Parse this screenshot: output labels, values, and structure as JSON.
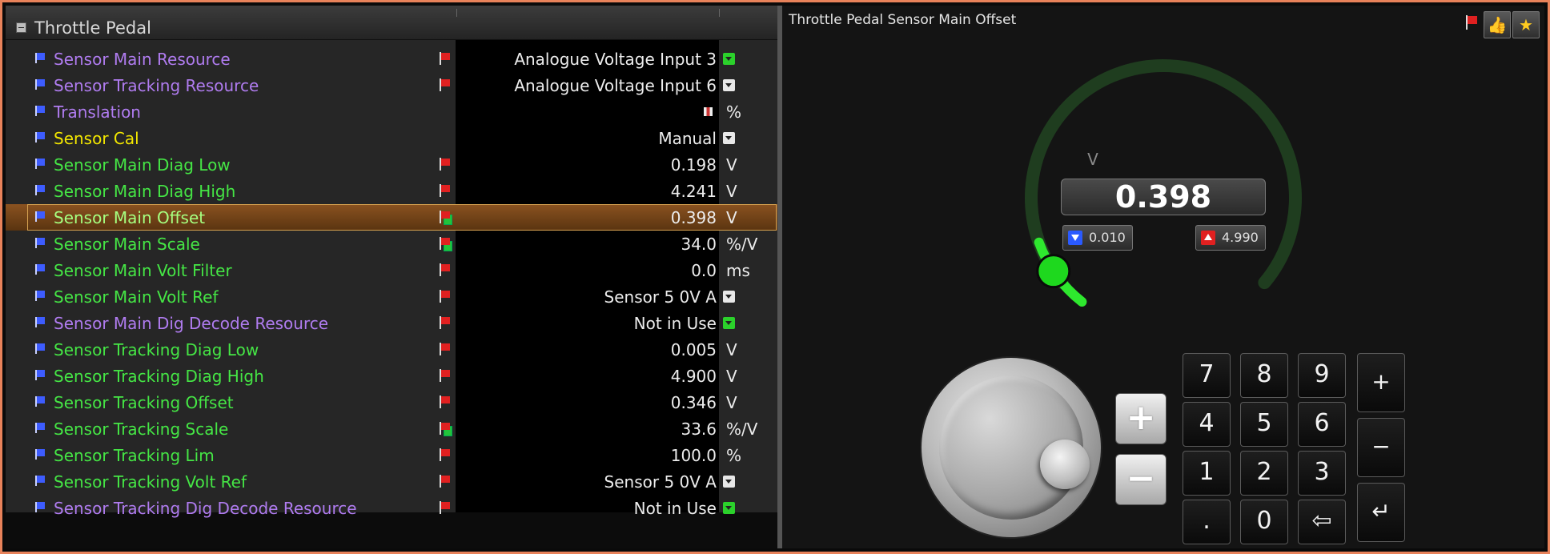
{
  "tree": {
    "title": "Throttle Pedal",
    "rows": [
      {
        "name": "Sensor Main Resource",
        "value": "Analogue Voltage Input 3",
        "unit": "",
        "color": "purple",
        "flag": true,
        "lock": false,
        "control": "dropdown-green"
      },
      {
        "name": "Sensor Tracking Resource",
        "value": "Analogue Voltage Input 6",
        "unit": "",
        "color": "purple",
        "flag": true,
        "lock": false,
        "control": "dropdown"
      },
      {
        "name": "Translation",
        "value": "",
        "unit": "%",
        "color": "purple",
        "flag": false,
        "lock": false,
        "control": "table"
      },
      {
        "name": "Sensor Cal",
        "value": "Manual",
        "unit": "",
        "color": "yellow",
        "flag": false,
        "lock": false,
        "control": "dropdown"
      },
      {
        "name": "Sensor Main Diag Low",
        "value": "0.198",
        "unit": "V",
        "color": "green",
        "flag": true,
        "lock": false,
        "control": ""
      },
      {
        "name": "Sensor Main Diag High",
        "value": "4.241",
        "unit": "V",
        "color": "green",
        "flag": true,
        "lock": false,
        "control": ""
      },
      {
        "name": "Sensor Main Offset",
        "value": "0.398",
        "unit": "V",
        "color": "sel",
        "flag": true,
        "lock": true,
        "control": "",
        "selected": true
      },
      {
        "name": "Sensor Main Scale",
        "value": "34.0",
        "unit": "%/V",
        "color": "green",
        "flag": true,
        "lock": true,
        "control": ""
      },
      {
        "name": "Sensor Main Volt Filter",
        "value": "0.0",
        "unit": "ms",
        "color": "green",
        "flag": true,
        "lock": false,
        "control": ""
      },
      {
        "name": "Sensor Main Volt Ref",
        "value": "Sensor 5 0V A",
        "unit": "",
        "color": "green",
        "flag": true,
        "lock": false,
        "control": "dropdown"
      },
      {
        "name": "Sensor Main Dig Decode Resource",
        "value": "Not in Use",
        "unit": "",
        "color": "purple",
        "flag": true,
        "lock": false,
        "control": "dropdown-green"
      },
      {
        "name": "Sensor Tracking Diag Low",
        "value": "0.005",
        "unit": "V",
        "color": "green",
        "flag": true,
        "lock": false,
        "control": ""
      },
      {
        "name": "Sensor Tracking Diag High",
        "value": "4.900",
        "unit": "V",
        "color": "green",
        "flag": true,
        "lock": false,
        "control": ""
      },
      {
        "name": "Sensor Tracking Offset",
        "value": "0.346",
        "unit": "V",
        "color": "green",
        "flag": true,
        "lock": false,
        "control": ""
      },
      {
        "name": "Sensor Tracking Scale",
        "value": "33.6",
        "unit": "%/V",
        "color": "green",
        "flag": true,
        "lock": true,
        "control": ""
      },
      {
        "name": "Sensor Tracking Lim",
        "value": "100.0",
        "unit": "%",
        "color": "green",
        "flag": true,
        "lock": false,
        "control": ""
      },
      {
        "name": "Sensor Tracking Volt Ref",
        "value": "Sensor 5 0V A",
        "unit": "",
        "color": "green",
        "flag": true,
        "lock": false,
        "control": "dropdown"
      },
      {
        "name": "Sensor Tracking Dig Decode Resource",
        "value": "Not in Use",
        "unit": "",
        "color": "purple",
        "flag": true,
        "lock": false,
        "control": "dropdown-green"
      }
    ]
  },
  "editor": {
    "title": "Throttle Pedal Sensor Main Offset",
    "unit": "V",
    "value": "0.398",
    "min_label": "0.010",
    "max_label": "4.990",
    "min": 0.01,
    "max": 4.99,
    "current": 0.398,
    "plus_label": "+",
    "minus_label": "−",
    "thumb_icon": "thumbs-up-icon",
    "star_icon": "star-icon",
    "thumb_glyph": "👍",
    "star_glyph": "★"
  },
  "keypad": {
    "keys": [
      "7",
      "8",
      "9",
      "4",
      "5",
      "6",
      "1",
      "2",
      "3",
      ".",
      "0",
      "⇦"
    ],
    "ops": [
      "+",
      "−",
      "↵"
    ]
  },
  "colors": {
    "purple": "#b07cf0",
    "green": "#45e645",
    "yellow": "#f2e600",
    "sel": "#a6ff80",
    "gauge_track": "#1f3d1f",
    "gauge_fill": "#2ee82e"
  }
}
